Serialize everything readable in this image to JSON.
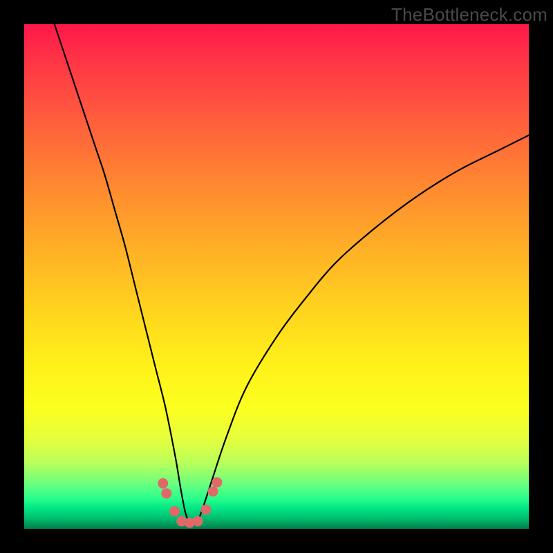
{
  "watermark": "TheBottleneck.com",
  "chart_data": {
    "type": "line",
    "title": "",
    "xlabel": "",
    "ylabel": "",
    "xlim": [
      0,
      100
    ],
    "ylim": [
      0,
      100
    ],
    "grid": false,
    "series": [
      {
        "name": "bottleneck-curve",
        "x": [
          6,
          8,
          10,
          12,
          14,
          16,
          18,
          20,
          22,
          24,
          26,
          28,
          30,
          31,
          32,
          33,
          34,
          35,
          37,
          40,
          44,
          50,
          56,
          62,
          70,
          78,
          86,
          94,
          100
        ],
        "y": [
          100,
          94,
          88,
          82,
          76,
          70,
          63,
          56,
          48,
          40,
          32,
          24,
          14,
          8,
          3,
          1,
          1,
          3,
          9,
          18,
          28,
          38,
          46,
          53,
          60,
          66,
          71,
          75,
          78
        ],
        "notes": "Values are read visually from the image; chart has no tick labels, so values are normalized to 0–100 in each axis as an approximation."
      }
    ],
    "markers": [
      {
        "name": "left-dot-upper",
        "x": 27.5,
        "y": 9.0
      },
      {
        "name": "left-dot-lower",
        "x": 28.2,
        "y": 7.0
      },
      {
        "name": "left-dot-inner",
        "x": 29.8,
        "y": 3.5
      },
      {
        "name": "floor-dot-1",
        "x": 31.2,
        "y": 1.5
      },
      {
        "name": "floor-dot-2",
        "x": 32.8,
        "y": 1.2
      },
      {
        "name": "floor-dot-3",
        "x": 34.4,
        "y": 1.5
      },
      {
        "name": "right-dot-inner",
        "x": 36.0,
        "y": 3.8
      },
      {
        "name": "right-dot-lower",
        "x": 37.4,
        "y": 7.4
      },
      {
        "name": "right-dot-upper",
        "x": 38.2,
        "y": 9.2
      }
    ],
    "colors": {
      "curve": "#000000",
      "marker": "#e06868",
      "gradient_top": "#ff1749",
      "gradient_mid": "#fff21a",
      "gradient_bottom": "#00804c",
      "frame": "#000000"
    }
  }
}
